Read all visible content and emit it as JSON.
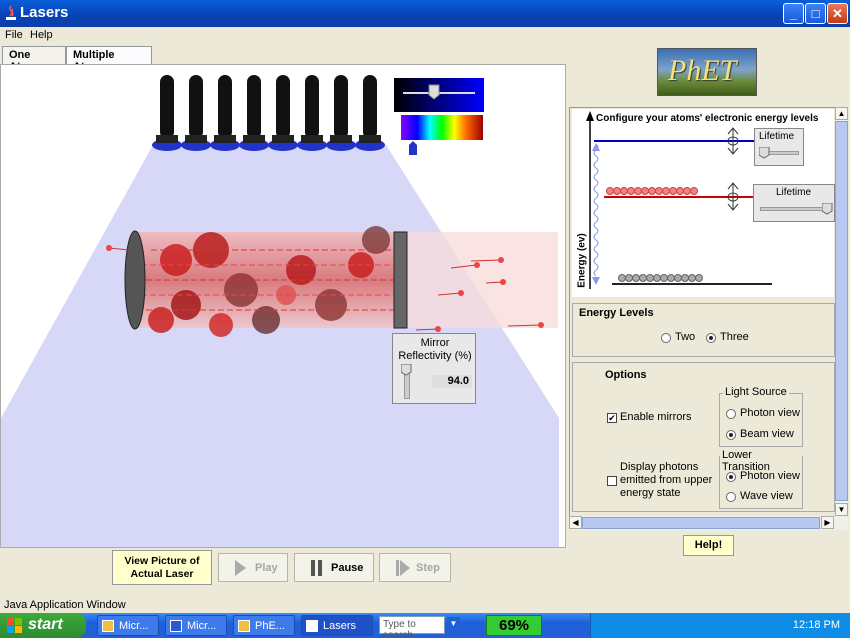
{
  "window": {
    "title": "Lasers"
  },
  "menu": {
    "items": [
      "File",
      "Help"
    ]
  },
  "tabs": [
    {
      "label": "One Atom",
      "active": false
    },
    {
      "label": "Multiple Atoms",
      "active": true
    }
  ],
  "canvas": {
    "mirror_reflectivity": {
      "label": "Mirror Reflectivity (%)",
      "value": "94.0"
    }
  },
  "controls": {
    "view_picture": "View Picture of Actual Laser",
    "play": "Play",
    "pause": "Pause",
    "step": "Step"
  },
  "logo": {
    "text": "PhET"
  },
  "energy_panel": {
    "title": "Configure your atoms' electronic energy levels",
    "y_axis": "Energy (ev)",
    "lifetime_label": "Lifetime",
    "upper_lifetime_level": 0.1,
    "middle_lifetime_level": 0.95
  },
  "energy_levels": {
    "title": "Energy Levels",
    "options": [
      "Two",
      "Three"
    ],
    "selected": "Three"
  },
  "options": {
    "title": "Options",
    "enable_mirrors": {
      "label": "Enable mirrors",
      "checked": true
    },
    "display_photons": {
      "label": "Display photons emitted from upper energy state",
      "checked": false
    },
    "light_source": {
      "title": "Light Source",
      "options": [
        "Photon view",
        "Beam view"
      ],
      "selected": "Beam view"
    },
    "lower_transition": {
      "title": "Lower Transition",
      "options": [
        "Photon view",
        "Wave view"
      ],
      "selected": "Photon view"
    }
  },
  "help_button": "Help!",
  "status_bar": "Java Application Window",
  "taskbar": {
    "start": "start",
    "tasks": [
      "Micr...",
      "Micr...",
      "PhE...",
      "Lasers"
    ],
    "search_placeholder": "Type to search",
    "battery": "69%",
    "clock": "12:18 PM"
  },
  "colors": {
    "accent_blue": "#0842b4",
    "pump_beam": "#c9c9f5",
    "upper_level": "#0000cc",
    "middle_level": "#cc0000"
  }
}
